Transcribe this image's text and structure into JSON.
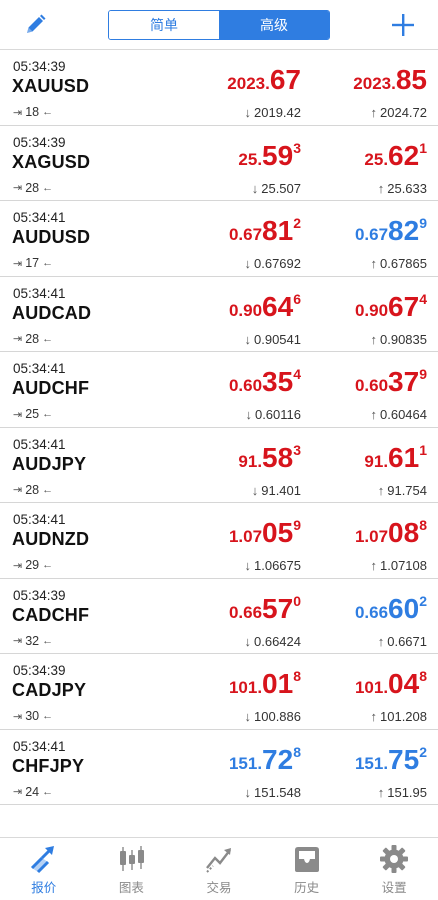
{
  "header": {
    "segments": [
      {
        "label": "简单",
        "active": false
      },
      {
        "label": "高级",
        "active": true
      }
    ],
    "accent_color": "#2f7de1",
    "left_icon": "pencil-edit-icon",
    "right_icon": "plus-icon"
  },
  "quotes": [
    {
      "time": "05:34:39",
      "symbol": "XAUUSD",
      "spread": "18",
      "bid": {
        "pre": "2023.",
        "big": "67",
        "sup": "",
        "color": "red"
      },
      "ask": {
        "pre": "2023.",
        "big": "85",
        "sup": "",
        "color": "red"
      },
      "low": "2019.42",
      "high": "2024.72"
    },
    {
      "time": "05:34:39",
      "symbol": "XAGUSD",
      "spread": "28",
      "bid": {
        "pre": "25.",
        "big": "59",
        "sup": "3",
        "color": "red"
      },
      "ask": {
        "pre": "25.",
        "big": "62",
        "sup": "1",
        "color": "red"
      },
      "low": "25.507",
      "high": "25.633"
    },
    {
      "time": "05:34:41",
      "symbol": "AUDUSD",
      "spread": "17",
      "bid": {
        "pre": "0.67",
        "big": "81",
        "sup": "2",
        "color": "red"
      },
      "ask": {
        "pre": "0.67",
        "big": "82",
        "sup": "9",
        "color": "blue"
      },
      "low": "0.67692",
      "high": "0.67865"
    },
    {
      "time": "05:34:41",
      "symbol": "AUDCAD",
      "spread": "28",
      "bid": {
        "pre": "0.90",
        "big": "64",
        "sup": "6",
        "color": "red"
      },
      "ask": {
        "pre": "0.90",
        "big": "67",
        "sup": "4",
        "color": "red"
      },
      "low": "0.90541",
      "high": "0.90835"
    },
    {
      "time": "05:34:41",
      "symbol": "AUDCHF",
      "spread": "25",
      "bid": {
        "pre": "0.60",
        "big": "35",
        "sup": "4",
        "color": "red"
      },
      "ask": {
        "pre": "0.60",
        "big": "37",
        "sup": "9",
        "color": "red"
      },
      "low": "0.60116",
      "high": "0.60464"
    },
    {
      "time": "05:34:41",
      "symbol": "AUDJPY",
      "spread": "28",
      "bid": {
        "pre": "91.",
        "big": "58",
        "sup": "3",
        "color": "red"
      },
      "ask": {
        "pre": "91.",
        "big": "61",
        "sup": "1",
        "color": "red"
      },
      "low": "91.401",
      "high": "91.754"
    },
    {
      "time": "05:34:41",
      "symbol": "AUDNZD",
      "spread": "29",
      "bid": {
        "pre": "1.07",
        "big": "05",
        "sup": "9",
        "color": "red"
      },
      "ask": {
        "pre": "1.07",
        "big": "08",
        "sup": "8",
        "color": "red"
      },
      "low": "1.06675",
      "high": "1.07108"
    },
    {
      "time": "05:34:39",
      "symbol": "CADCHF",
      "spread": "32",
      "bid": {
        "pre": "0.66",
        "big": "57",
        "sup": "0",
        "color": "red"
      },
      "ask": {
        "pre": "0.66",
        "big": "60",
        "sup": "2",
        "color": "blue"
      },
      "low": "0.66424",
      "high": "0.6671"
    },
    {
      "time": "05:34:39",
      "symbol": "CADJPY",
      "spread": "30",
      "bid": {
        "pre": "101.",
        "big": "01",
        "sup": "8",
        "color": "red"
      },
      "ask": {
        "pre": "101.",
        "big": "04",
        "sup": "8",
        "color": "red"
      },
      "low": "100.886",
      "high": "101.208"
    },
    {
      "time": "05:34:41",
      "symbol": "CHFJPY",
      "spread": "24",
      "bid": {
        "pre": "151.",
        "big": "72",
        "sup": "8",
        "color": "blue"
      },
      "ask": {
        "pre": "151.",
        "big": "75",
        "sup": "2",
        "color": "blue"
      },
      "low": "151.548",
      "high": "151.95"
    }
  ],
  "tabbar": [
    {
      "label": "报价",
      "icon": "quotes-arrows-icon",
      "active": true
    },
    {
      "label": "图表",
      "icon": "candlestick-chart-icon",
      "active": false
    },
    {
      "label": "交易",
      "icon": "trade-line-icon",
      "active": false
    },
    {
      "label": "历史",
      "icon": "history-inbox-icon",
      "active": false
    },
    {
      "label": "设置",
      "icon": "gear-icon",
      "active": false
    }
  ],
  "colors": {
    "red": "#d7141c",
    "blue": "#2f7de1",
    "inactive": "#8a8a8a"
  }
}
